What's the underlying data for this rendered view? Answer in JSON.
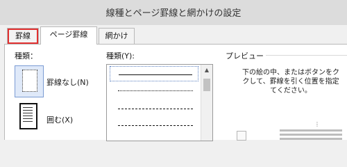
{
  "window": {
    "title": "線種とページ罫線と網かけの設定"
  },
  "tabs": [
    {
      "label": "罫線"
    },
    {
      "label": "ページ罫線"
    },
    {
      "label": "網かけ"
    }
  ],
  "setting": {
    "label": "種類：",
    "options": [
      {
        "label": "罫線なし(N)",
        "icon": "no-border-icon"
      },
      {
        "label": "囲む(X)",
        "icon": "box-border-icon"
      }
    ]
  },
  "style": {
    "label": "種類(Y):",
    "items": [
      "solid",
      "dotted",
      "dash-small",
      "dash"
    ]
  },
  "preview": {
    "label": "プレビュー",
    "instruction": "下の絵の中、またはボタンをク\nクして、罫線を引く位置を指定\nてください。"
  },
  "colors": {
    "highlight": "#e23030",
    "selection": "#7a9bd3"
  }
}
